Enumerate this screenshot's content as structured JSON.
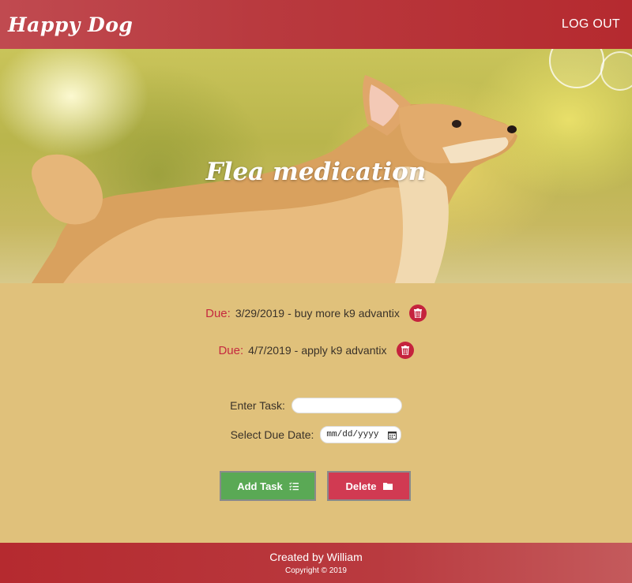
{
  "header": {
    "brand": "Happy Dog",
    "logout_label": "LOG OUT"
  },
  "hero": {
    "title": "Flea medication"
  },
  "tasks": [
    {
      "due_label": "Due:",
      "date": "3/29/2019",
      "separator": "-",
      "text": "buy more k9 advantix"
    },
    {
      "due_label": "Due:",
      "date": "4/7/2019",
      "separator": "-",
      "text": "apply k9 advantix"
    }
  ],
  "form": {
    "task_label": "Enter Task:",
    "task_value": "",
    "date_label": "Select Due Date:",
    "date_placeholder": "mm/dd/yyyy"
  },
  "buttons": {
    "add_label": "Add Task",
    "delete_label": "Delete"
  },
  "footer": {
    "credit": "Created by William",
    "copyright": "Copyright © 2019"
  },
  "colors": {
    "header": "#b93a3f",
    "page_background": "#e0c17b",
    "due_label": "#c5293f",
    "add_button": "#5aa955",
    "delete_button": "#d13a52"
  }
}
